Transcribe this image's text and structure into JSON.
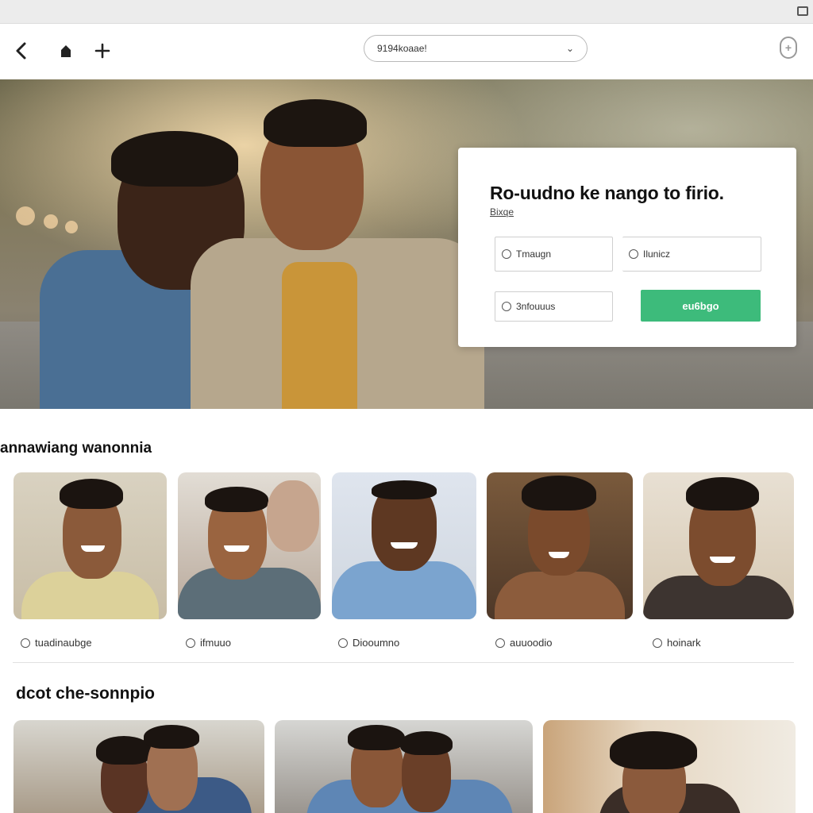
{
  "browser": {
    "url": "9194koaae!"
  },
  "hero": {
    "title": "Ro-uudno ke nango to firio.",
    "subtitle": "Bixqe",
    "field_1": "Tmaugn",
    "field_2": "Ilunicz",
    "field_3": "3nfouuus",
    "cta": "eu6bgo"
  },
  "section_1": {
    "title": "annawiang wanonnia",
    "cards": [
      {
        "label": "tuadinaubge"
      },
      {
        "label": "ifmuuo"
      },
      {
        "label": "Diooumno"
      },
      {
        "label": "auuoodio"
      },
      {
        "label": "hoinark"
      }
    ]
  },
  "section_2": {
    "title": "dcot che-sonnpio"
  },
  "colors": {
    "accent": "#3dbb7b"
  }
}
